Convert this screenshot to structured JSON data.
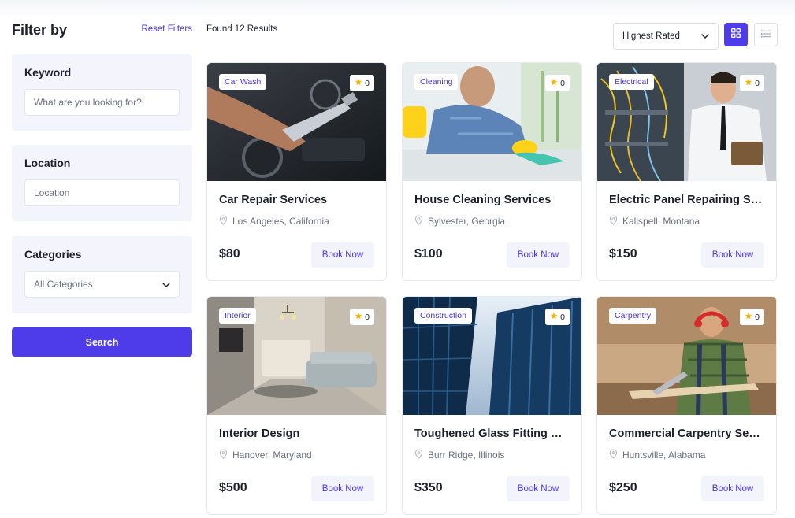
{
  "filters": {
    "title": "Filter by",
    "reset_label": "Reset Filters",
    "keyword": {
      "label": "Keyword",
      "placeholder": "What are you looking for?"
    },
    "location": {
      "label": "Location",
      "placeholder": "Location"
    },
    "categories": {
      "label": "Categories",
      "selected": "All Categories"
    },
    "search_label": "Search"
  },
  "toolbar": {
    "results_text": "Found 12 Results",
    "sort_selected": "Highest Rated"
  },
  "services": [
    {
      "category": "Car Wash",
      "rating": "0",
      "title": "Car Repair Services",
      "location": "Los Angeles, California",
      "price": "$80",
      "book_label": "Book Now"
    },
    {
      "category": "Cleaning",
      "rating": "0",
      "title": "House Cleaning Services",
      "location": "Sylvester, Georgia",
      "price": "$100",
      "book_label": "Book Now"
    },
    {
      "category": "Electrical",
      "rating": "0",
      "title": "Electric Panel Repairing Se...",
      "location": "Kalispell, Montana",
      "price": "$150",
      "book_label": "Book Now"
    },
    {
      "category": "Interior",
      "rating": "0",
      "title": "Interior Design",
      "location": "Hanover, Maryland",
      "price": "$500",
      "book_label": "Book Now"
    },
    {
      "category": "Construction",
      "rating": "0",
      "title": "Toughened Glass Fitting Se...",
      "location": "Burr Ridge, Illinois",
      "price": "$350",
      "book_label": "Book Now"
    },
    {
      "category": "Carpentry",
      "rating": "0",
      "title": "Commercial Carpentry Serv...",
      "location": "Huntsville, Alabama",
      "price": "$250",
      "book_label": "Book Now"
    }
  ],
  "colors": {
    "accent": "#4e3be9",
    "panel_bg": "#f4f4fd",
    "star": "#f5b400"
  }
}
